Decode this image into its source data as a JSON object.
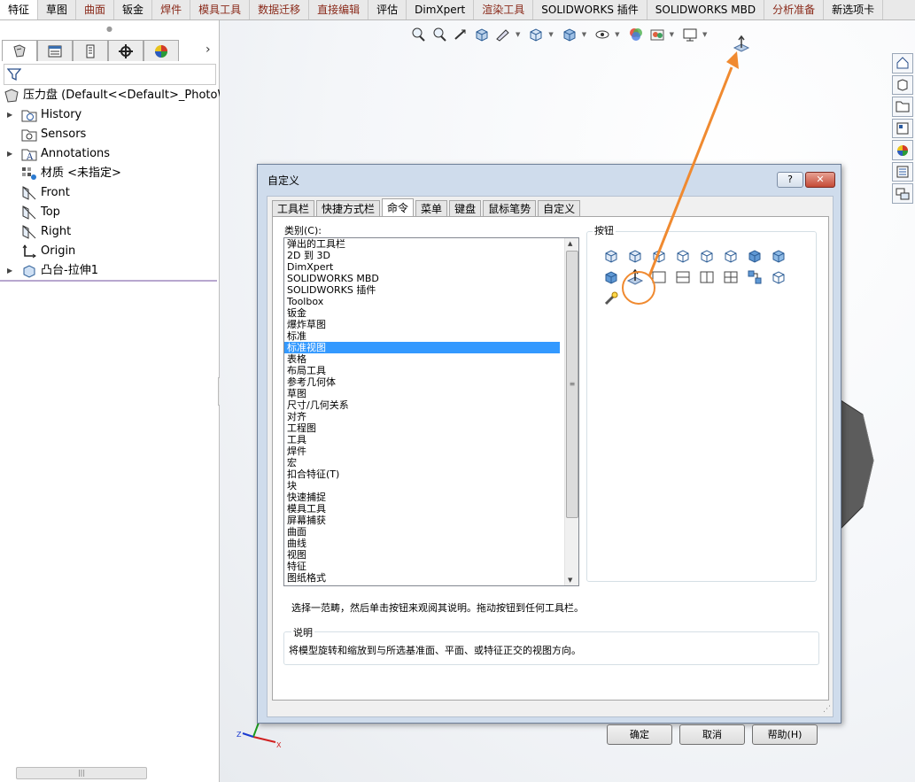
{
  "tabs": [
    {
      "label": "特征",
      "state": "active"
    },
    {
      "label": "草图",
      "state": "plain"
    },
    {
      "label": "曲面",
      "state": "normal"
    },
    {
      "label": "钣金",
      "state": "plain"
    },
    {
      "label": "焊件",
      "state": "normal"
    },
    {
      "label": "模具工具",
      "state": "normal"
    },
    {
      "label": "数据迁移",
      "state": "normal"
    },
    {
      "label": "直接编辑",
      "state": "normal"
    },
    {
      "label": "评估",
      "state": "plain"
    },
    {
      "label": "DimXpert",
      "state": "plain"
    },
    {
      "label": "渲染工具",
      "state": "normal"
    },
    {
      "label": "SOLIDWORKS 插件",
      "state": "plain"
    },
    {
      "label": "SOLIDWORKS MBD",
      "state": "plain"
    },
    {
      "label": "分析准备",
      "state": "normal"
    },
    {
      "label": "新选项卡",
      "state": "plain"
    }
  ],
  "feature_manager": {
    "tab_icons": [
      "feature-tree-icon",
      "property-manager-icon",
      "configuration-manager-icon",
      "dimxpert-manager-icon",
      "display-manager-icon"
    ],
    "tree": [
      {
        "label": "压力盘  (Default<<Default>_PhotoWor",
        "icon": "part-icon",
        "expandable": false,
        "indent": 0
      },
      {
        "label": "History",
        "icon": "history-icon",
        "expandable": true,
        "indent": 1
      },
      {
        "label": "Sensors",
        "icon": "sensors-icon",
        "expandable": false,
        "indent": 1
      },
      {
        "label": "Annotations",
        "icon": "annotations-icon",
        "expandable": true,
        "indent": 1
      },
      {
        "label": "材质 <未指定>",
        "icon": "material-icon",
        "expandable": false,
        "indent": 1
      },
      {
        "label": "Front",
        "icon": "plane-icon",
        "expandable": false,
        "indent": 1
      },
      {
        "label": "Top",
        "icon": "plane-icon",
        "expandable": false,
        "indent": 1
      },
      {
        "label": "Right",
        "icon": "plane-icon",
        "expandable": false,
        "indent": 1
      },
      {
        "label": "Origin",
        "icon": "origin-icon",
        "expandable": false,
        "indent": 1
      },
      {
        "label": "凸台-拉伸1",
        "icon": "extrude-icon",
        "expandable": true,
        "indent": 1
      }
    ]
  },
  "view_toolbar": [
    "zoom-to-fit-icon",
    "zoom-to-area-icon",
    "previous-view-icon",
    "section-view-icon",
    "dynamic-annotation-icon",
    "view-orientation-icon",
    "display-style-icon",
    "hide-show-icon",
    "edit-appearance-icon",
    "apply-scene-icon",
    "view-settings-icon"
  ],
  "task_pane": [
    "home-icon",
    "design-library-icon",
    "file-explorer-icon",
    "view-palette-icon",
    "appearances-icon",
    "custom-properties-icon",
    "forum-icon"
  ],
  "dialog": {
    "title": "自定义",
    "help_label": "?",
    "close_label": "✕",
    "tabs": [
      {
        "label": "工具栏",
        "active": false
      },
      {
        "label": "快捷方式栏",
        "active": false
      },
      {
        "label": "命令",
        "active": true
      },
      {
        "label": "菜单",
        "active": false
      },
      {
        "label": "键盘",
        "active": false
      },
      {
        "label": "鼠标笔势",
        "active": false
      },
      {
        "label": "自定义",
        "active": false
      }
    ],
    "category_label": "类别(C):",
    "categories": [
      "弹出的工具栏",
      "2D 到 3D",
      "DimXpert",
      "SOLIDWORKS MBD",
      "SOLIDWORKS 插件",
      "Toolbox",
      "钣金",
      "爆炸草图",
      "标准",
      "标准视图",
      "表格",
      "布局工具",
      "参考几何体",
      "草图",
      "尺寸/几何关系",
      "对齐",
      "工程图",
      "工具",
      "焊件",
      "宏",
      "扣合特征(T)",
      "块",
      "快速捕捉",
      "模具工具",
      "屏幕捕获",
      "曲面",
      "曲线",
      "视图",
      "特征",
      "图纸格式"
    ],
    "selected_category": "标准视图",
    "buttons_label": "按钮",
    "command_buttons": [
      "front-view-icon",
      "back-view-icon",
      "left-view-icon",
      "right-view-icon",
      "top-view-icon",
      "bottom-view-icon",
      "isometric-view-icon",
      "trimetric-view-icon",
      "dimetric-view-icon",
      "normal-to-icon",
      "single-view-icon",
      "two-view-horizontal-icon",
      "two-view-vertical-icon",
      "four-view-icon",
      "link-views-icon",
      "view-cube-icon",
      "view-selector-icon"
    ],
    "highlighted_button": "normal-to-icon",
    "instruction": "选择一范畴，然后单击按钮来观阅其说明。拖动按钮到任何工具栏。",
    "description_label": "说明",
    "description": "将模型旋转和缩放到与所选基准面、平面、或特征正交的视图方向。",
    "ok_label": "确定",
    "cancel_label": "取消",
    "help_button_label": "帮助(H)"
  },
  "colors": {
    "accent_orange": "#f08a30",
    "selection_blue": "#3399ff",
    "tab_text_red": "#8a2a1a",
    "dialog_frame": "#cfdcec"
  }
}
